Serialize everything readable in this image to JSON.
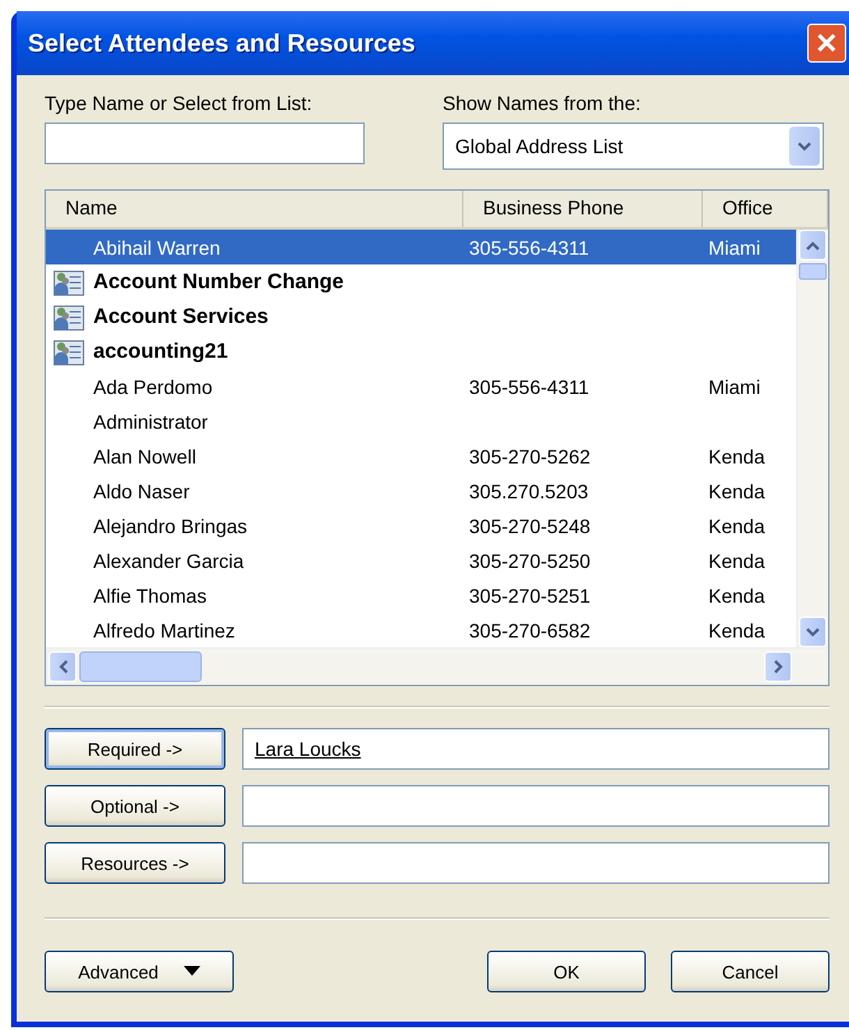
{
  "window": {
    "title": "Select Attendees and Resources",
    "close": "✕"
  },
  "search": {
    "label": "Type Name or Select from List:"
  },
  "address_book": {
    "label": "Show Names from the:",
    "value": "Global Address List"
  },
  "table": {
    "columns": [
      "Name",
      "Business Phone",
      "Office"
    ],
    "rows": [
      {
        "kind": "person",
        "name": "Abihail Warren",
        "phone": "305-556-4311",
        "office": "Miami",
        "selected": true
      },
      {
        "kind": "group",
        "name": "Account Number Change",
        "selected": false
      },
      {
        "kind": "group",
        "name": "Account Services",
        "selected": false
      },
      {
        "kind": "group",
        "name": "accounting21",
        "selected": false
      },
      {
        "kind": "person",
        "name": "Ada Perdomo",
        "phone": "305-556-4311",
        "office": "Miami",
        "selected": false
      },
      {
        "kind": "person",
        "name": "Administrator",
        "selected": false
      },
      {
        "kind": "person",
        "name": "Alan Nowell",
        "phone": "305-270-5262",
        "office": "Kenda",
        "selected": false
      },
      {
        "kind": "person",
        "name": "Aldo Naser",
        "phone": "305.270.5203",
        "office": "Kenda",
        "selected": false
      },
      {
        "kind": "person",
        "name": "Alejandro Bringas",
        "phone": "305-270-5248",
        "office": "Kenda",
        "selected": false
      },
      {
        "kind": "person",
        "name": "Alexander Garcia",
        "phone": "305-270-5250",
        "office": "Kenda",
        "selected": false
      },
      {
        "kind": "person",
        "name": "Alfie Thomas",
        "phone": "305-270-5251",
        "office": "Kenda",
        "selected": false
      },
      {
        "kind": "person",
        "name": "Alfredo Martinez",
        "phone": "305-270-6582",
        "office": "Kenda",
        "selected": false
      }
    ]
  },
  "recipients": [
    {
      "button": "Required ->",
      "value": "Lara Loucks",
      "default": true
    },
    {
      "button": "Optional ->",
      "default": false
    },
    {
      "button": "Resources ->",
      "default": false
    }
  ],
  "buttons": [
    {
      "label": "Advanced",
      "kind": "menu"
    },
    {
      "label": "OK",
      "kind": "plain"
    },
    {
      "label": "Cancel",
      "kind": "plain"
    }
  ]
}
